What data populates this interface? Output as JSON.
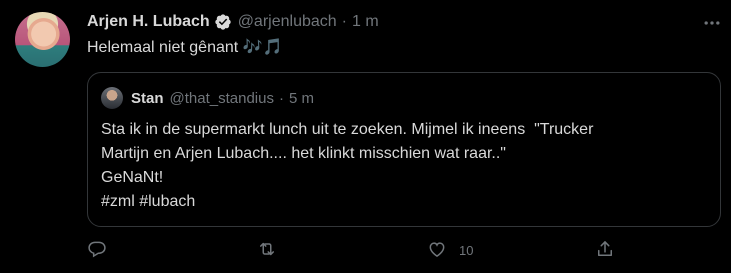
{
  "author": {
    "name": "Arjen H. Lubach",
    "handle": "@arjenlubach",
    "separator": "·",
    "time": "1 m",
    "verified": true
  },
  "tweet": {
    "text": "Helemaal niet gênant",
    "emoji": "🎶🎵"
  },
  "quoted": {
    "name": "Stan",
    "handle": "@that_standius",
    "separator": "·",
    "time": "5 m",
    "lines": [
      "Sta ik in de supermarkt lunch uit te zoeken. Mijmel ik ineens  \"Trucker",
      "Martijn en Arjen Lubach.... het klinkt misschien wat raar..\"",
      "GeNaNt!",
      "#zml #lubach"
    ]
  },
  "actions": {
    "reply_count": "",
    "retweet_count": "",
    "like_count": "10"
  },
  "colors": {
    "background": "#000000",
    "text": "#d9d9d9",
    "muted": "#71767b",
    "border": "#333639",
    "verified": "#d9d9d9"
  },
  "icons": [
    "verified-badge-icon",
    "more-icon",
    "reply-icon",
    "retweet-icon",
    "like-icon",
    "share-icon"
  ]
}
